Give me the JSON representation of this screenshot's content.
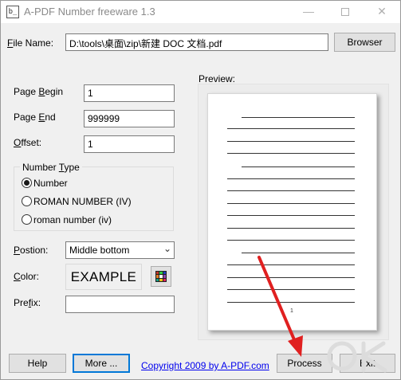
{
  "window": {
    "icon_text": "b_",
    "title": "A-PDF Number freeware 1.3",
    "min_glyph": "—",
    "close_glyph": "✕"
  },
  "file": {
    "label_pre": "",
    "label_ul": "F",
    "label_post": "ile Name:",
    "value": "D:\\tools\\桌面\\zip\\新建 DOC 文档.pdf",
    "browse_label": "Browser"
  },
  "fields": {
    "page_begin": {
      "label_pre": "Page ",
      "label_ul": "B",
      "label_post": "egin",
      "value": "1"
    },
    "page_end": {
      "label_pre": "Page ",
      "label_ul": "E",
      "label_post": "nd",
      "value": "999999"
    },
    "offset": {
      "label_pre": "",
      "label_ul": "O",
      "label_post": "ffset:",
      "value": "1"
    }
  },
  "number_type": {
    "title_pre": "Number ",
    "title_ul": "T",
    "title_post": "ype",
    "options": [
      {
        "label": "Number",
        "selected": true
      },
      {
        "label": "ROMAN NUMBER (IV)",
        "selected": false
      },
      {
        "label": "roman number (iv)",
        "selected": false
      }
    ]
  },
  "position": {
    "label_pre": "",
    "label_ul": "P",
    "label_post": "ostion:",
    "value": "Middle bottom"
  },
  "color": {
    "label_pre": "",
    "label_ul": "C",
    "label_post": "olor:",
    "example_text": "EXAMPLE",
    "palette": [
      "#c0392b",
      "#2ecc40",
      "#1f3fbf",
      "#e67e22",
      "#ffffff",
      "#8e44ad",
      "#16a085",
      "#f1c40f",
      "#e91e63"
    ]
  },
  "prefix": {
    "label_pre": "Pre",
    "label_ul": "f",
    "label_post": "ix:",
    "value": ""
  },
  "preview": {
    "label": "Preview:",
    "page_number": "1"
  },
  "footer": {
    "help_label": "Help",
    "more_label": "More ...",
    "copyright_link": "Copyright 2009 by A-PDF.com",
    "process_label": "Process",
    "exit_label": "Exit"
  },
  "colors": {
    "window_bg": "#f0f0f0",
    "focus_border": "#0078d7",
    "link": "#0000ee",
    "annotation_arrow": "#e02020"
  }
}
